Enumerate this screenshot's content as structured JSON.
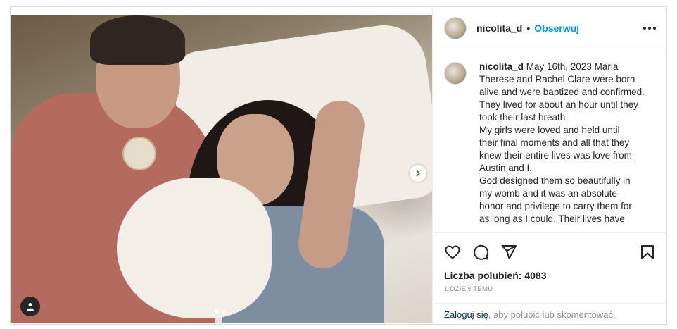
{
  "post": {
    "username": "nicolita_d",
    "separator": "•",
    "follow_label": "Obserwuj",
    "caption_user": "nicolita_d",
    "caption_body": " May 16th, 2023 Maria\nTherese and Rachel Clare were born\nalive and were baptized and confirmed.\nThey lived for about an hour until they\ntook their last breath.\nMy girls were loved and held until\ntheir final moments and all that they\nknew their entire lives was love from\nAustin and I.\nGod designed them so beautifully in\nmy womb and it was an absolute\nhonor and privilege to carry them for\nas long as I could. Their lives have",
    "likes": "Liczba polubień: 4083",
    "time": "1 DZIEŃ TEMU",
    "login_link": "Zaloguj się",
    "login_rest": ", aby polubić lub skomentować."
  },
  "carousel": {
    "current": 1,
    "total": 2
  },
  "icons": {
    "more": "more-options-icon",
    "like": "heart-icon",
    "comment": "comment-icon",
    "share": "share-icon",
    "save": "bookmark-icon",
    "next": "chevron-right-icon",
    "tag": "user-tag-icon"
  },
  "colors": {
    "link": "#0095f6",
    "text": "#262626",
    "muted": "#8e8e8e"
  }
}
